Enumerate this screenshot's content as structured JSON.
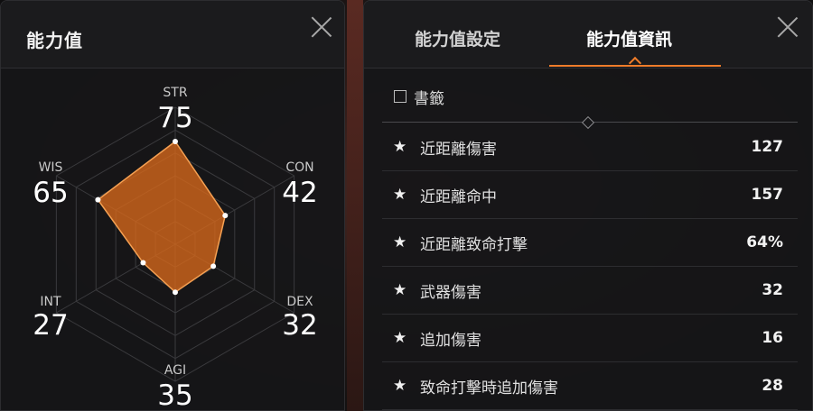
{
  "left_panel": {
    "title": "能力值",
    "stats": [
      {
        "key": "str",
        "name": "STR",
        "value": "75",
        "amount": 75
      },
      {
        "key": "con",
        "name": "CON",
        "value": "42",
        "amount": 42
      },
      {
        "key": "dex",
        "name": "DEX",
        "value": "32",
        "amount": 32
      },
      {
        "key": "agi",
        "name": "AGI",
        "value": "35",
        "amount": 35
      },
      {
        "key": "int",
        "name": "INT",
        "value": "27",
        "amount": 27
      },
      {
        "key": "wis",
        "name": "WIS",
        "value": "65",
        "amount": 65
      }
    ],
    "radar_max": 100,
    "colors": {
      "fill": "#d9691b",
      "stroke": "#f5a052",
      "grid": "#3a3a3d"
    }
  },
  "right_panel": {
    "tabs": [
      {
        "label": "能力值設定",
        "active": false
      },
      {
        "label": "能力值資訊",
        "active": true
      }
    ],
    "bookmark": {
      "label": "書籤",
      "checked": false
    },
    "rows": [
      {
        "label": "近距離傷害",
        "value": "127"
      },
      {
        "label": "近距離命中",
        "value": "157"
      },
      {
        "label": "近距離致命打擊",
        "value": "64%"
      },
      {
        "label": "武器傷害",
        "value": "32"
      },
      {
        "label": "追加傷害",
        "value": "16"
      },
      {
        "label": "致命打擊時追加傷害",
        "value": "28"
      }
    ],
    "accent_color": "#ef7c2a"
  }
}
